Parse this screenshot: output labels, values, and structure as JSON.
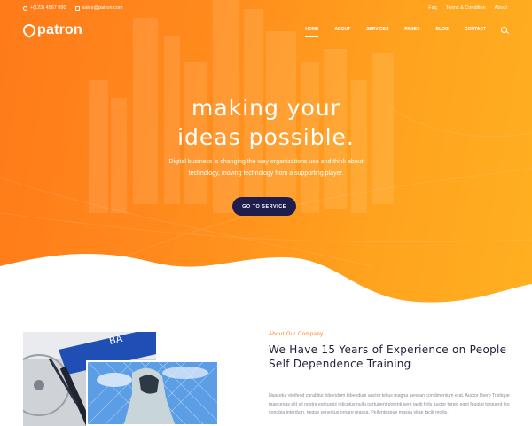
{
  "topbar": {
    "phone": "+(123) 4567 890",
    "email": "sales@patron.com",
    "links": [
      "Faq",
      "Terms & Condition",
      "About"
    ]
  },
  "brand": {
    "name": "patron"
  },
  "nav": {
    "items": [
      "HOME",
      "ABOUT",
      "SERVICES",
      "PAGES",
      "BLOG",
      "CONTACT"
    ],
    "active": "HOME"
  },
  "hero": {
    "headline_line1": "making your",
    "headline_line2": "ideas possible.",
    "subtext": "Digital business is changing the way organizations use and think about technology, moving technology from a supporting player.",
    "cta_label": "GO TO SERVICE"
  },
  "about": {
    "tag": "About Our Company",
    "title": "We Have 15 Years of Experience on People Self Dependence Training",
    "body": "Nascetur eleifend curabitur bibendum bibendum auctor tellus magna aenean condimentum erat. Auctor libero Tristique maecenas elit sit nostra est turpis ridiculus nulla parturient potenti sem taciti felis auctor turpis eget feugiat torquent leo conubia interdum, neque senectus ornare massa. Pellentesque massa vitae taciti mollis."
  },
  "colors": {
    "accent": "#ff7a1a",
    "accent_light": "#ffb020",
    "cta": "#1f1d4e",
    "heading": "#1e1e3a"
  }
}
